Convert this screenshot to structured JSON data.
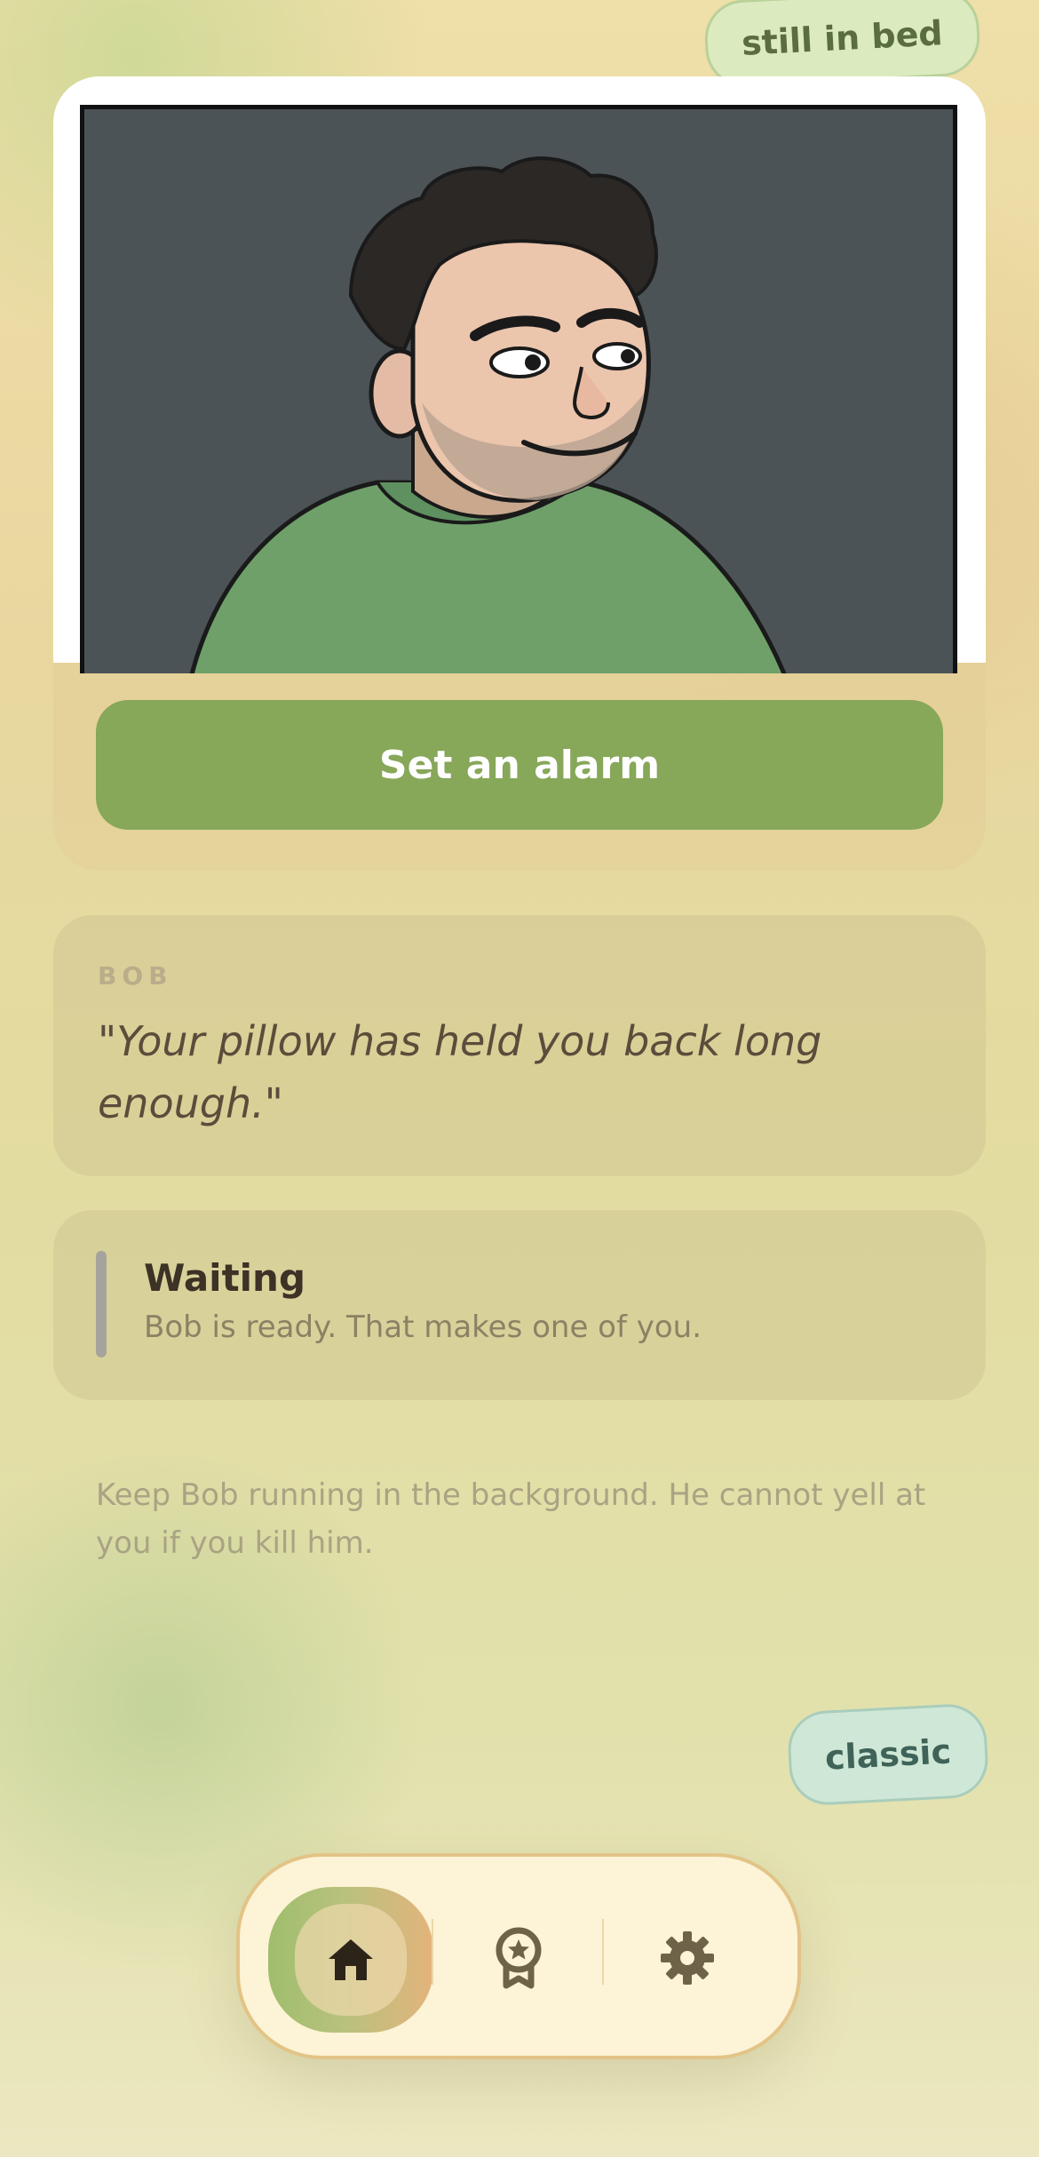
{
  "tags": {
    "top": "still in bed",
    "bottom": "classic"
  },
  "hero": {
    "button_label": "Set an alarm"
  },
  "quote": {
    "speaker": "BOB",
    "text": "\"Your pillow has held you back long enough.\""
  },
  "status": {
    "title": "Waiting",
    "subtitle": "Bob is ready. That makes one of you."
  },
  "hint": "Keep Bob running in the background. He cannot yell at you if you kill him.",
  "nav": {
    "items": [
      {
        "icon": "home-icon",
        "active": true
      },
      {
        "icon": "award-icon",
        "active": false
      },
      {
        "icon": "gear-icon",
        "active": false
      }
    ]
  },
  "colors": {
    "accent_green": "#87a759",
    "card_bg": "#4c5356",
    "shirt_green": "#6fa06a"
  }
}
